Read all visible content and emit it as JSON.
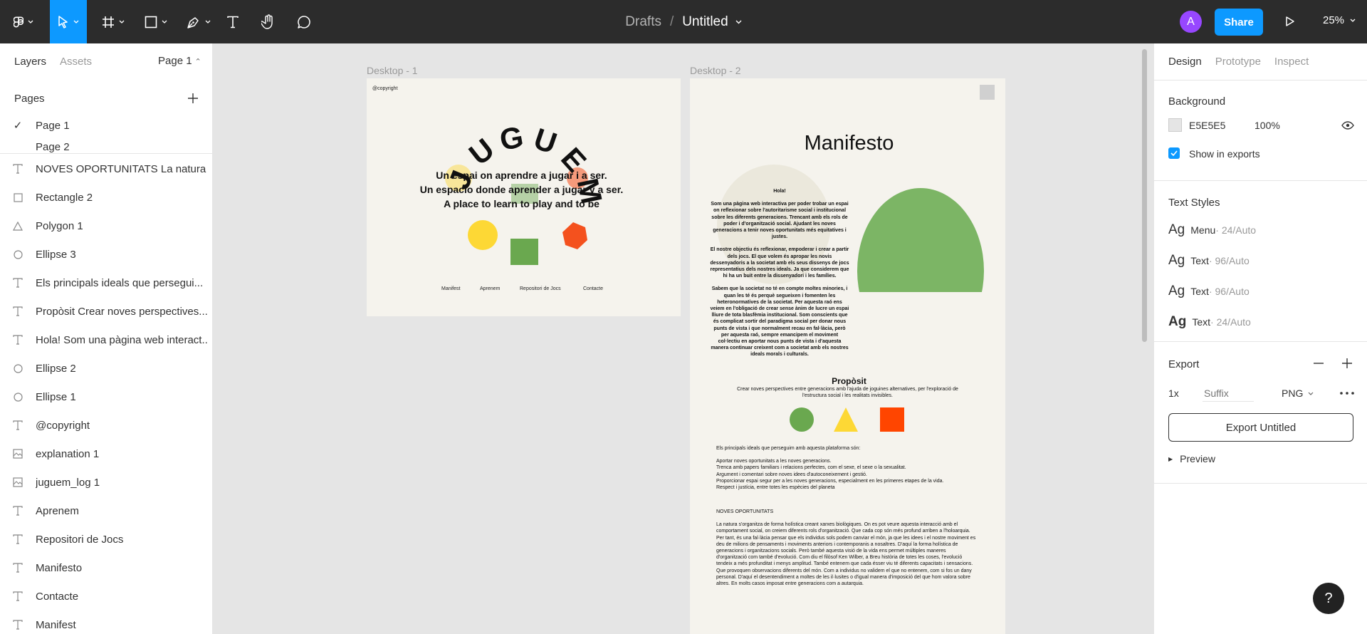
{
  "toolbar": {
    "tools": [
      "main-menu",
      "move",
      "frame",
      "shape",
      "pen",
      "text",
      "hand",
      "comment"
    ],
    "breadcrumb_parent": "Drafts",
    "breadcrumb_separator": "/",
    "document_title": "Untitled",
    "avatar_letter": "A",
    "share_label": "Share",
    "zoom_label": "25%"
  },
  "left_panel": {
    "tabs": [
      "Layers",
      "Assets"
    ],
    "page_selector": "Page 1",
    "pages_header": "Pages",
    "pages": [
      "Page 1",
      "Page 2"
    ],
    "layers": [
      {
        "icon": "text-icon",
        "name": "NOVES OPORTUNITATS La natura ..."
      },
      {
        "icon": "rectangle-icon",
        "name": "Rectangle 2"
      },
      {
        "icon": "polygon-icon",
        "name": "Polygon 1"
      },
      {
        "icon": "ellipse-icon",
        "name": "Ellipse 3"
      },
      {
        "icon": "text-icon",
        "name": "Els principals ideals que persegui..."
      },
      {
        "icon": "text-icon",
        "name": "Propòsit Crear noves perspectives..."
      },
      {
        "icon": "text-icon",
        "name": "Hola! Som una pàgina web interact..."
      },
      {
        "icon": "ellipse-icon",
        "name": "Ellipse 2"
      },
      {
        "icon": "ellipse-icon",
        "name": "Ellipse 1"
      },
      {
        "icon": "text-icon",
        "name": "@copyright"
      },
      {
        "icon": "image-icon",
        "name": "explanation 1"
      },
      {
        "icon": "image-icon",
        "name": "juguem_log 1"
      },
      {
        "icon": "text-icon",
        "name": "Aprenem"
      },
      {
        "icon": "text-icon",
        "name": "Repositori de Jocs"
      },
      {
        "icon": "text-icon",
        "name": "Manifesto"
      },
      {
        "icon": "text-icon",
        "name": "Contacte"
      },
      {
        "icon": "text-icon",
        "name": "Manifest"
      }
    ]
  },
  "canvas": {
    "frame1": {
      "label": "Desktop - 1",
      "copyright": "@copyright",
      "logo_letters": [
        "J",
        "U",
        "G",
        "U",
        "E",
        "M"
      ],
      "lines": [
        "Un espai on aprendre a jugar i a ser.",
        "Un espacio donde aprender a jugar y a ser.",
        "A place to learn to play and to be"
      ],
      "nav": [
        "Manifest",
        "Aprenem",
        "Repositori de Jocs",
        "Contacte"
      ],
      "colors": {
        "yellow": "#fdd835",
        "green": "#6aa84f",
        "red": "#f4511e",
        "background": "#f5f3ed"
      }
    },
    "frame2": {
      "label": "Desktop - 2",
      "title": "Manifesto",
      "hola_title": "Hola!",
      "hola_p1": "Som una pàgina web interactiva per poder trobar un espai on reflexionar sobre l'autoritarisme social i institucional sobre les diferents generacions. Trencant amb els rols de poder i d'organització social. Ajudant les noves generacions a tenir noves oportunitats més equitatives i justes.",
      "hola_p2": "El nostre objectiu és reflexionar, empoderar i crear a partir dels jocs. El que volem és apropar les novis dessenyadoris a la societat amb els seus dissenys de jocs representatius dels nostres ideals. Ja que considerem que hi ha un buit entre la dissenyadori i les famílies.",
      "hola_p3": "Sabem que la societat no té en compte moltes minories, i quan les té és perquè segueixen i fomenten les heteronormatives de la societat. Per aquesta raó ens veiem en l'obligació de crear sense ànim de lucre un espai lliure de tota blasfèmia institucional. Som conscients que és complicat sortir del paradigma social per donar nous punts de vista i que normalment recau en fal·làcia, però per aquesta raó, sempre emancipem el moviment col·lectiu en aportar nous punts de vista i d'aquesta manera continuar creixent com a societat amb els nostres ideals morals i culturals.",
      "proposit_title": "Propòsit",
      "proposit_text": "Crear noves perspectives entre generacions amb l'ajuda de joguines alternatives, per l'exploració de l'estructura social i les realitats invisibles.",
      "ideals_intro": "Els principals ideals que perseguim amb aquesta plataforma són:",
      "ideals": [
        "Aportar noves oportunitats a les noves generacions.",
        "Trenca amb papers familiars i relacions perfectes, com el sexe, el sexe o la sexualitat.",
        "Argument i comentari sobre noves idees d'autoconeixement i gestió.",
        "Proporcionar espai segur per a les noves generacions, especialment en les primeres etapes de la vida.",
        "Respect i justícia, entre totes les espècies del planeta"
      ],
      "noves_title": "NOVES OPORTUNITATS",
      "noves_text": "La natura s'organitza de forma holística creant xarxes biològiques. On es pot veure aquesta interacció amb el comportament social, on creiem diferents rols d'organització. Que cada cop són més profund arriben a l'holoarquia. Per tant, és una fal·làcia pensar que els individus sols podem canviar el món, ja que les idees i el nostre moviment es deu de milions de pensaments i moviments anteriors i contemporanis a nosaltres. D'aquí la forma holística de generacions i organitzacions socials. Però també aquesta visió de la vida ens permet múltiples maneres d'organització com també d'evolució. Com diu el filòsof Ken Wilber, a Breu història de totes les coses, l'evolució tendeix a més profunditat i menys amplitud. També entenem que cada ésser viu té diferents capacitats i sensacions. Que provoquen observacions diferents del món. Com a individus no validem el que no entenem, com si fos un dany personal. D'aquí el desentendiment a moltes de les il·lusites o d'igual manera d'imposició del que hom valora sobre altres. En molts casos imposat entre generacions com a autarquia.",
      "colors": {
        "green": "#6aa84f",
        "yellow": "#fdd835",
        "red": "#ff4500",
        "background": "#f5f3ed"
      }
    }
  },
  "right_panel": {
    "tabs": [
      "Design",
      "Prototype",
      "Inspect"
    ],
    "background_title": "Background",
    "bg_hex": "E5E5E5",
    "bg_swatch": "#e5e5e5",
    "bg_opacity": "100%",
    "show_in_exports": "Show in exports",
    "text_styles_title": "Text Styles",
    "text_styles": [
      {
        "ag": "Ag",
        "name": "Menu",
        "meta": " · 24/Auto"
      },
      {
        "ag": "Ag",
        "name": "Text",
        "meta": " · 96/Auto"
      },
      {
        "ag": "Ag",
        "name": "Text",
        "meta": " · 96/Auto"
      },
      {
        "ag": "Ag",
        "name": "Text",
        "meta": " · 24/Auto"
      }
    ],
    "export_title": "Export",
    "export_scale": "1x",
    "export_suffix_placeholder": "Suffix",
    "export_format": "PNG",
    "export_button": "Export Untitled",
    "preview_label": "Preview"
  },
  "help_label": "?"
}
